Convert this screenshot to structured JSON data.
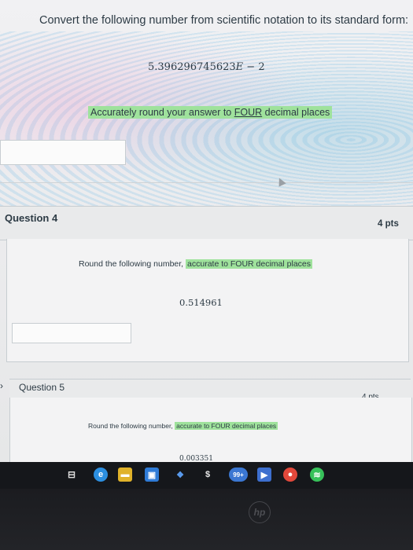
{
  "question3": {
    "prompt": "Convert the following number from scientific notation to its standard form:",
    "value_mantissa": "5.396296745623",
    "value_e": "E",
    "value_tail": " − 2",
    "instruction_prefix": "Accurately round your answer to ",
    "instruction_emph": "FOUR",
    "instruction_suffix": " decimal places"
  },
  "question4": {
    "title": "Question 4",
    "points": "4 pts",
    "prompt_prefix": "Round the following number, ",
    "prompt_highlight": "accurate to FOUR decimal places",
    "value": "0.514961"
  },
  "question5": {
    "title": "Question 5",
    "points": "4 pts",
    "prompt_prefix": "Round the following number, ",
    "prompt_highlight": "accurate to FOUR decimal places",
    "value": "0.003351"
  },
  "taskbar": {
    "mail_badge": "99+",
    "bezel_logo": "hp"
  },
  "colors": {
    "highlight": "#9fe29c",
    "text": "#2d3b45"
  }
}
